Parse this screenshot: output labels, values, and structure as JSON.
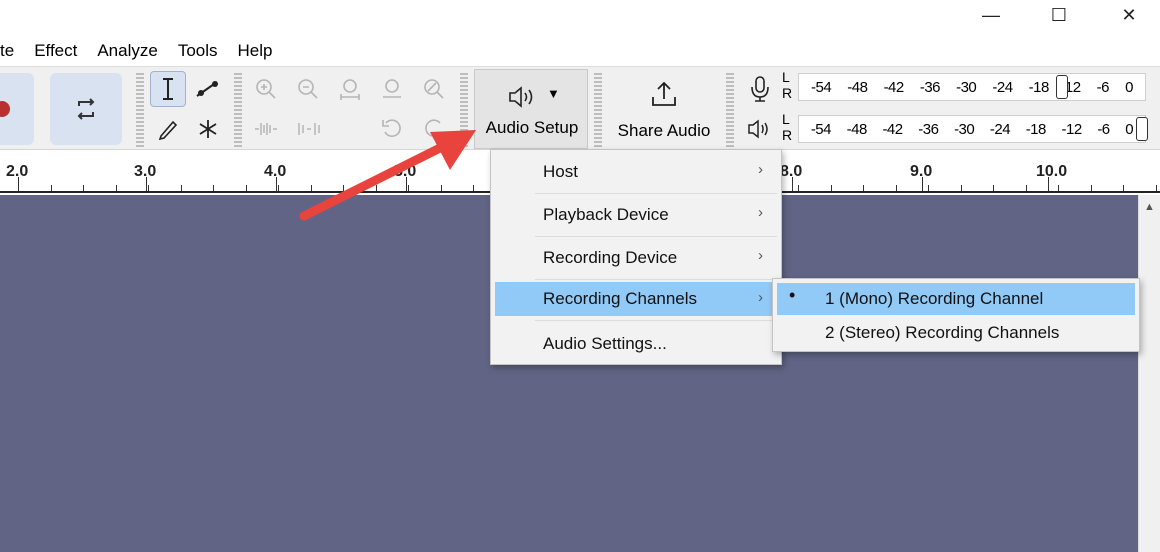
{
  "window": {
    "minimize": "—",
    "maximize": "☐",
    "close": "✕"
  },
  "menubar": [
    "te",
    "Effect",
    "Analyze",
    "Tools",
    "Help"
  ],
  "toolbar": {
    "audio_setup_label": "Audio Setup",
    "share_audio_label": "Share Audio"
  },
  "meters": {
    "channel_left": "L",
    "channel_right": "R",
    "record_scale": [
      "-54",
      "-48",
      "-42",
      "-36",
      "-30",
      "-24",
      "-18",
      "12",
      "-6",
      "0"
    ],
    "playback_scale": [
      "-54",
      "-48",
      "-42",
      "-36",
      "-30",
      "-24",
      "-18",
      "-12",
      "-6",
      "0"
    ]
  },
  "ruler": {
    "labels": [
      "2.0",
      "3.0",
      "4.0",
      "5.0",
      "8.0",
      "9.0",
      "10.0"
    ]
  },
  "audio_setup_menu": {
    "items": [
      {
        "label": "Host",
        "submenu": true
      },
      {
        "label": "Playback Device",
        "submenu": true
      },
      {
        "label": "Recording Device",
        "submenu": true
      },
      {
        "label": "Recording Channels",
        "submenu": true,
        "highlighted": true
      },
      {
        "label": "Audio Settings...",
        "submenu": false
      }
    ]
  },
  "recording_channels_submenu": {
    "items": [
      {
        "label": "1 (Mono) Recording Channel",
        "selected": true
      },
      {
        "label": "2 (Stereo) Recording Channels",
        "selected": false
      }
    ]
  },
  "colors": {
    "accent": "#91c9f7",
    "track_bg": "#616485",
    "record": "#b8312f",
    "arrow": "#e8433d"
  }
}
